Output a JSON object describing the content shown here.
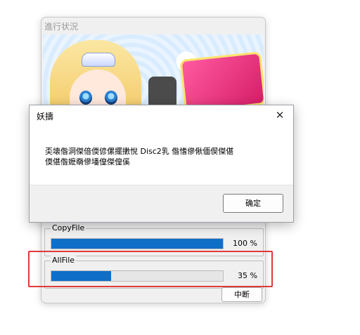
{
  "progress_window": {
    "title": "進行状況",
    "copy_file": {
      "label": "CopyFile",
      "percent_text": "100 %",
      "value": 1.0
    },
    "all_file": {
      "label": "AllFile",
      "percent_text": "35 %",
      "value": 0.35
    },
    "cancel_label": "中断"
  },
  "dialog": {
    "title": "妖擣",
    "message_line1": "奀壊偺洞傑偣偄偐傫擺擻悅 Disc2乳 偺愭傪偢偭偰傑偡",
    "message_line2": "偄偡偺嬷奣傪墦偟傑偟傒",
    "ok_label": "确定",
    "close_symbol": "✕"
  },
  "colors": {
    "progress_fill": "#0f6ec8",
    "highlight": "#e03a3a"
  }
}
